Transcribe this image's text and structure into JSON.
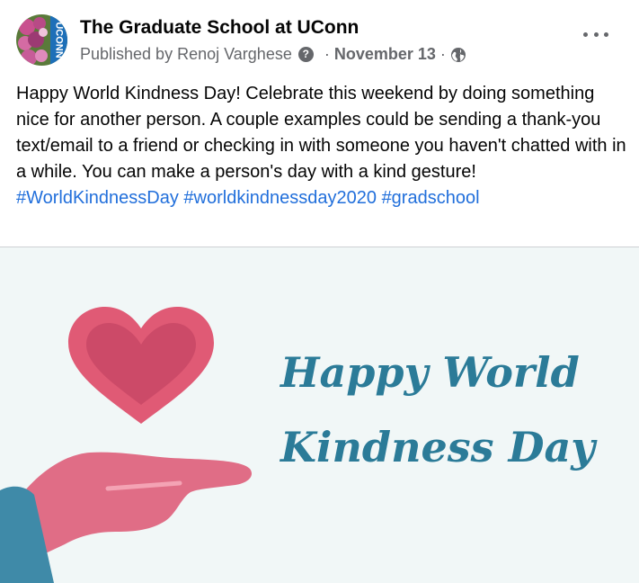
{
  "post": {
    "page_name": "The Graduate School at UConn",
    "published_by_prefix": "Published by",
    "author": "Renoj Varghese",
    "date": "November 13",
    "help_glyph": "?",
    "privacy_icon": "globe-icon",
    "more_icon": "more-horizontal-icon",
    "avatar_text": "UCONN",
    "body_text": "Happy World Kindness Day! Celebrate this weekend by doing something nice for another person. A couple examples could be sending a thank-you text/email to a friend or checking in with someone you haven't chatted with in a while. You can make a person's day with a kind gesture! ",
    "hashtags": [
      "#WorldKindnessDay",
      "#worldkindnessday2020",
      "#gradschool"
    ]
  },
  "image": {
    "headline_line1": "Happy World",
    "headline_line2": "Kindness Day",
    "heart_icon": "heart-icon",
    "hand_icon": "open-hand-icon"
  },
  "colors": {
    "link": "#216fdb",
    "headline": "#2b7b98",
    "heart": "#e05a75",
    "hand": "#e06d86",
    "sleeve": "#3f8aa8",
    "image_bg": "#f1f7f7"
  }
}
